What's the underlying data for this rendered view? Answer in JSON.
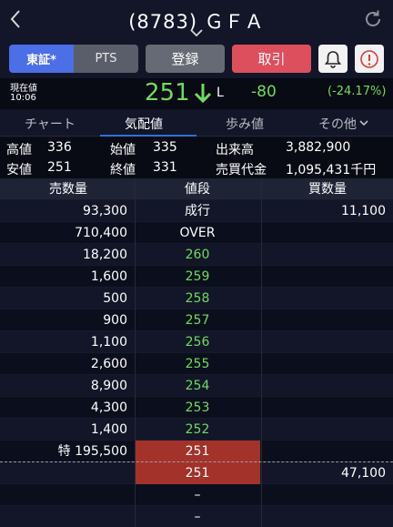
{
  "header": {
    "title": "(8783) ＧＦＡ"
  },
  "buttons": {
    "market_tse": "東証*",
    "market_pts": "PTS",
    "register": "登録",
    "trade": "取引"
  },
  "price": {
    "label": "現在値",
    "time": "10:06",
    "value": "251",
    "marker": "L",
    "change": "-80",
    "change_pct": "(-24.17%)"
  },
  "tabs": [
    {
      "label": "チャート"
    },
    {
      "label": "気配値"
    },
    {
      "label": "歩み値"
    },
    {
      "label": "その他"
    }
  ],
  "stats": {
    "high_label": "高値",
    "high": "336",
    "open_label": "始値",
    "open": "335",
    "volume_label": "出来高",
    "volume": "3,882,900",
    "low_label": "安値",
    "low": "251",
    "close_label": "終値",
    "close": "331",
    "turnover_label": "売買代金",
    "turnover": "1,095,431千円"
  },
  "book": {
    "headers": {
      "sell_qty": "売数量",
      "price": "値段",
      "buy_qty": "買数量"
    },
    "rows": [
      {
        "sell": "93,300",
        "price": "成行",
        "buy": "11,100"
      },
      {
        "sell": "710,400",
        "price": "OVER",
        "buy": ""
      },
      {
        "sell": "18,200",
        "price": "260",
        "buy": ""
      },
      {
        "sell": "1,600",
        "price": "259",
        "buy": ""
      },
      {
        "sell": "500",
        "price": "258",
        "buy": ""
      },
      {
        "sell": "900",
        "price": "257",
        "buy": ""
      },
      {
        "sell": "1,100",
        "price": "256",
        "buy": ""
      },
      {
        "sell": "2,600",
        "price": "255",
        "buy": ""
      },
      {
        "sell": "8,900",
        "price": "254",
        "buy": ""
      },
      {
        "sell": "4,300",
        "price": "253",
        "buy": ""
      },
      {
        "sell": "1,400",
        "price": "252",
        "buy": ""
      },
      {
        "sell": "特 195,500",
        "price": "251",
        "buy": ""
      },
      {
        "sell": "",
        "price": "251",
        "buy": "47,100"
      },
      {
        "sell": "",
        "price": "–",
        "buy": ""
      },
      {
        "sell": "",
        "price": "–",
        "buy": ""
      }
    ]
  },
  "colors": {
    "accent_blue": "#4c6ee6",
    "trade_red": "#de4f5d",
    "price_green": "#6fdb5e",
    "highlight_red": "#a3322b"
  }
}
